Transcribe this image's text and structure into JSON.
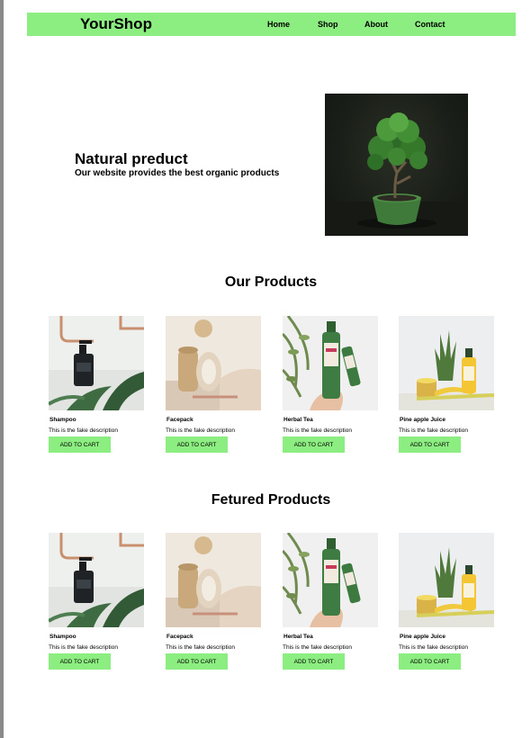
{
  "header": {
    "logo": "YourShop",
    "nav": [
      "Home",
      "Shop",
      "About",
      "Contact"
    ]
  },
  "hero": {
    "title": "Natural preduct",
    "subtitle": "Our website provides the best organic products",
    "image_icon": "bonsai-tree-image"
  },
  "products_section": {
    "title": "Our Products",
    "items": [
      {
        "name": "Shampoo",
        "description": "This is the fake description",
        "button": "ADD TO CART",
        "image": "shampoo-bottle-image"
      },
      {
        "name": "Facepack",
        "description": "This is the fake description",
        "button": "ADD TO CART",
        "image": "facepack-jar-image"
      },
      {
        "name": "Herbal Tea",
        "description": "This is the fake description",
        "button": "ADD TO CART",
        "image": "herbal-tea-bottle-image"
      },
      {
        "name": "Pine apple Juice",
        "description": "This is the fake description",
        "button": "ADD TO CART",
        "image": "pineapple-juice-image"
      }
    ]
  },
  "featured_section": {
    "title": "Fetured Products",
    "items": [
      {
        "name": "Shampoo",
        "description": "This is the fake description",
        "button": "ADD TO CART",
        "image": "shampoo-bottle-image"
      },
      {
        "name": "Facepack",
        "description": "This is the fake description",
        "button": "ADD TO CART",
        "image": "facepack-jar-image"
      },
      {
        "name": "Herbal Tea",
        "description": "This is the fake description",
        "button": "ADD TO CART",
        "image": "herbal-tea-bottle-image"
      },
      {
        "name": "Pine apple Juice",
        "description": "This is the fake description",
        "button": "ADD TO CART",
        "image": "pineapple-juice-image"
      }
    ]
  },
  "colors": {
    "accent": "#8ced80",
    "background": "#ffffff",
    "text": "#000000"
  }
}
